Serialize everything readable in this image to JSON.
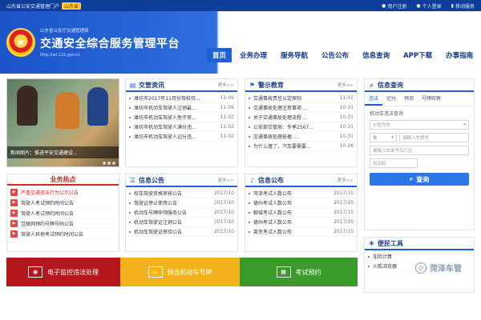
{
  "topbar": {
    "left_text": "山东省公安交通管理门户",
    "region": "山东省",
    "links": [
      "用户注册",
      "个人登录",
      "移动服务"
    ]
  },
  "brand": {
    "small": "山东省公安厅交通管理局",
    "title": "交通安全综合服务管理平台",
    "url": "http://sd.122.gov.cn"
  },
  "nav": [
    "首页",
    "业务办理",
    "服务导航",
    "公告公布",
    "信息查询",
    "APP下载",
    "办事指南"
  ],
  "banner": {
    "caption": "新闻图片：推进平安交通建设..."
  },
  "traffic_news": {
    "title": "交管资讯",
    "more": "更多>>",
    "items": [
      {
        "t": "潍坊市2017年11月份驾校待...",
        "d": "11-06"
      },
      {
        "t": "潍坊市机动车驾驶人注销最...",
        "d": "11-06"
      },
      {
        "t": "潍坊市机动车驾驶人免于审...",
        "d": "11-02"
      },
      {
        "t": "潍坊市机动车驾驶人满分违...",
        "d": "11-02"
      },
      {
        "t": "潍坊市机动车驾驶人记分违...",
        "d": "11-02"
      }
    ]
  },
  "warning": {
    "title": "警示教育",
    "more": "更多>>",
    "items": [
      {
        "t": "交通事故责任认定原则",
        "d": "11-01"
      },
      {
        "t": "交通事故处理注意事项 ...",
        "d": "10-31"
      },
      {
        "t": "关于交通事故处理流程 ...",
        "d": "10-31"
      },
      {
        "t": "公安部交管局：冬季2567...",
        "d": "10-31"
      },
      {
        "t": "交通事故处理依据 ...",
        "d": "10-31"
      },
      {
        "t": "为什么撞了，汽车要需要...",
        "d": "10-26"
      }
    ]
  },
  "hot_business": {
    "title": "业务热点",
    "items": [
      "严重交通违法行为公示公告",
      "驾驶人考试预约时间公告",
      "驾驶人考试预约时间公告",
      "互联网预约号牌号码公告",
      "驾驶人异地考试预约时间公告"
    ]
  },
  "info_notice": {
    "title": "信息公告",
    "more": "更多>>",
    "items": [
      {
        "t": "校车驾驶资格审核公告",
        "d": "2017/10"
      },
      {
        "t": "驾驶证停止使用公告",
        "d": "2017/10"
      },
      {
        "t": "机动车号牌申领服务公告",
        "d": "2017/10"
      },
      {
        "t": "机动车驾驶证注销公告",
        "d": "2017/10"
      },
      {
        "t": "机动车驾驶证审验公告",
        "d": "2017/10"
      }
    ]
  },
  "info_publish": {
    "title": "信息公布",
    "more": "更多>>",
    "items": [
      {
        "t": "菏泽考试人数公布",
        "d": "2017/10"
      },
      {
        "t": "德州考试人数公布",
        "d": "2017/10"
      },
      {
        "t": "聊城考试人数公布",
        "d": "2017/10"
      },
      {
        "t": "德州考试人数公布",
        "d": "2017/10"
      },
      {
        "t": "莱芜考试人数公布",
        "d": "2017/10"
      }
    ]
  },
  "query": {
    "title": "信息查询",
    "tabs": [
      "违法",
      "记分",
      "预测",
      "号牌邮寄"
    ],
    "label": "机动车违法查询",
    "vehicle_type": "小型汽车",
    "province": "鲁",
    "plate_placeholder": "请输入车牌号",
    "vin_placeholder": "请输入车架号后六位",
    "captcha_placeholder": "验证码",
    "button": "查询"
  },
  "tools": {
    "title": "便民工具",
    "items": [
      "车险计算",
      "火狐浏览器"
    ]
  },
  "tiles": [
    {
      "label": "电子监控违法处理",
      "color": "#b3161b",
      "icon": "camera-icon"
    },
    {
      "label": "预选机动车号牌",
      "color": "#f2b31c",
      "icon": "plate-icon"
    },
    {
      "label": "考试预约",
      "color": "#3a9a2a",
      "icon": "calendar-icon"
    }
  ],
  "watermark": "菏泽车管"
}
